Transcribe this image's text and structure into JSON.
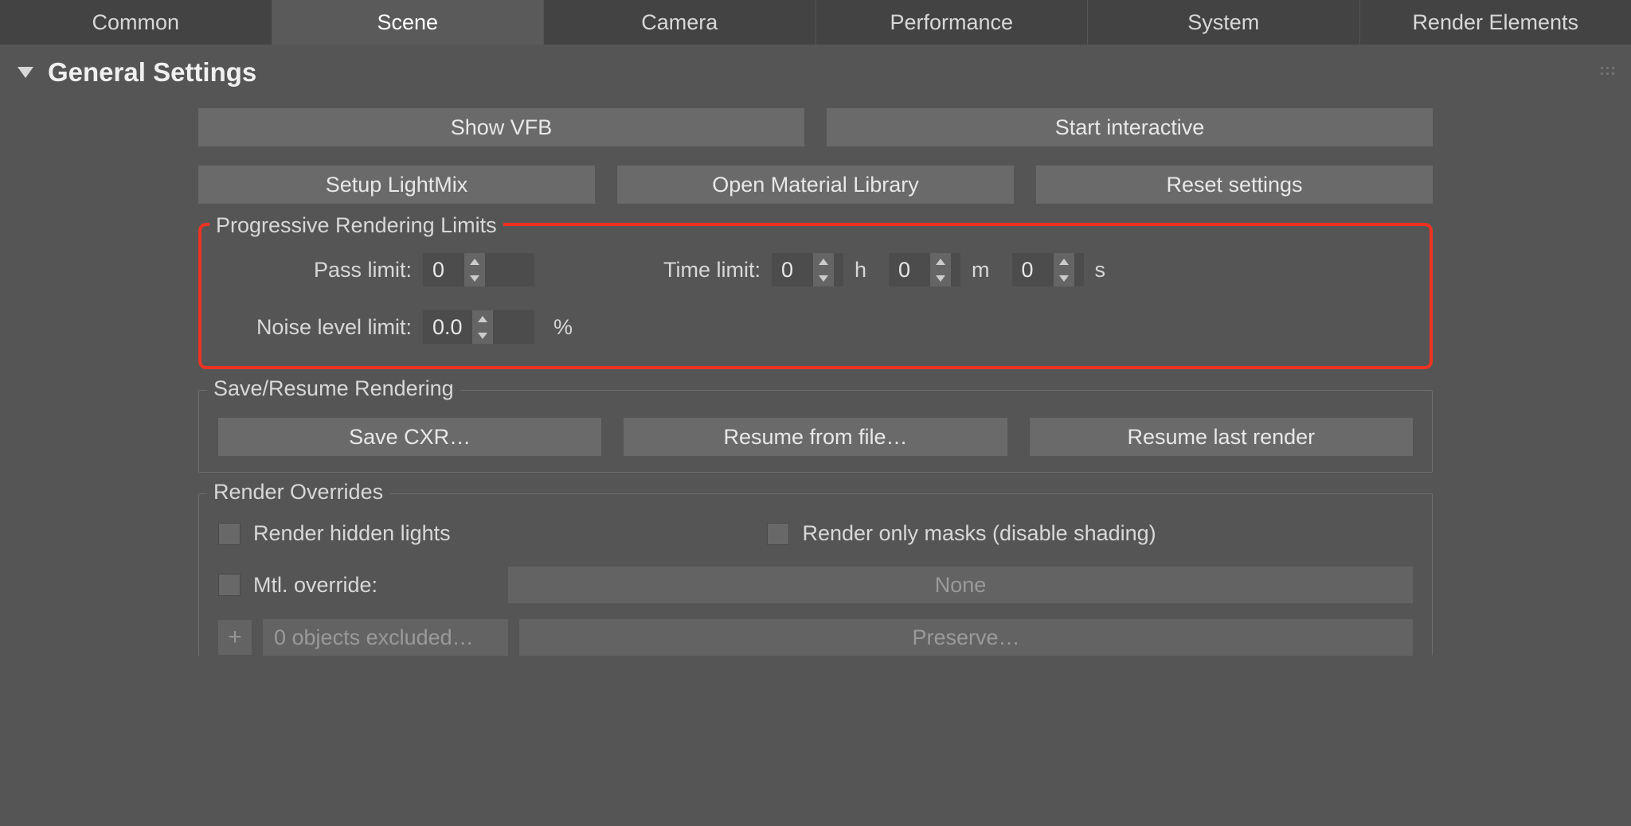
{
  "tabs": {
    "common": "Common",
    "scene": "Scene",
    "camera": "Camera",
    "performance": "Performance",
    "system": "System",
    "render_elements": "Render Elements"
  },
  "section_title": "General Settings",
  "buttons": {
    "show_vfb": "Show VFB",
    "start_interactive": "Start interactive",
    "setup_lightmix": "Setup LightMix",
    "open_mat_lib": "Open Material Library",
    "reset_settings": "Reset settings",
    "save_cxr": "Save CXR…",
    "resume_file": "Resume from file…",
    "resume_last": "Resume last render",
    "mtl_none": "None",
    "preserve": "Preserve…",
    "excluded": "0 objects excluded…",
    "plus": "+"
  },
  "groups": {
    "progressive": "Progressive Rendering Limits",
    "save_resume": "Save/Resume Rendering",
    "render_overrides": "Render Overrides"
  },
  "labels": {
    "pass_limit": "Pass limit:",
    "time_limit": "Time limit:",
    "noise_limit": "Noise level limit:",
    "h": "h",
    "m": "m",
    "s": "s",
    "percent": "%",
    "render_hidden": "Render hidden lights",
    "render_masks": "Render only masks (disable shading)",
    "mtl_override": "Mtl. override:"
  },
  "values": {
    "pass_limit": "0",
    "time_h": "0",
    "time_m": "0",
    "time_s": "0",
    "noise_limit": "0.0"
  }
}
